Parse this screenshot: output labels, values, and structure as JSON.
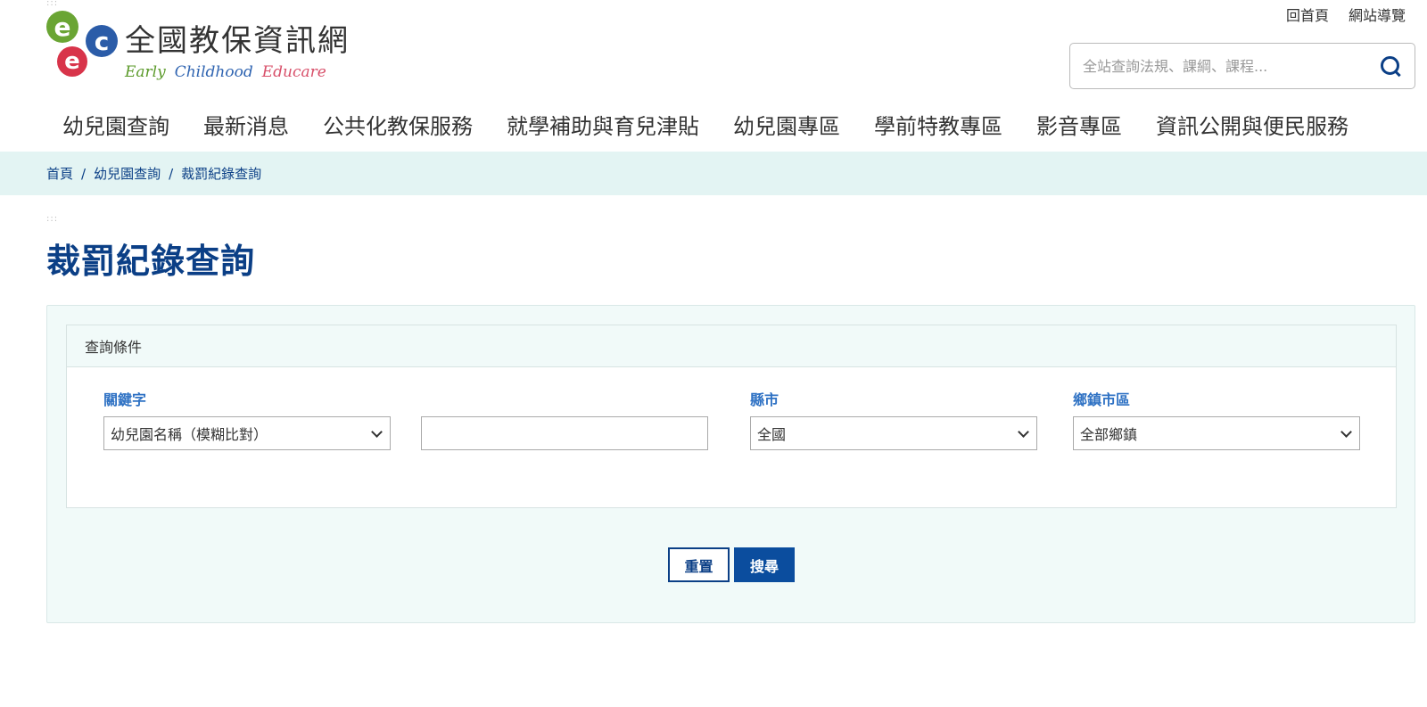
{
  "logo": {
    "title": "全國教保資訊網",
    "subtitle_1": "Early",
    "subtitle_2": "Childhood",
    "subtitle_3": "Educare",
    "colors": {
      "green": "#6aa534",
      "blue": "#2b5ca8",
      "red": "#d8344a"
    }
  },
  "top_links": {
    "home": "回首頁",
    "sitemap": "網站導覽"
  },
  "search": {
    "placeholder": "全站查詢法規、課綱、課程..."
  },
  "nav": [
    "幼兒園查詢",
    "最新消息",
    "公共化教保服務",
    "就學補助與育兒津貼",
    "幼兒園專區",
    "學前特教專區",
    "影音專區",
    "資訊公開與便民服務"
  ],
  "breadcrumb": {
    "home": "首頁",
    "level2": "幼兒園查詢",
    "current": "裁罰紀錄查詢",
    "sep": "/"
  },
  "page": {
    "title": "裁罰紀錄查詢"
  },
  "query": {
    "legend": "查詢條件",
    "keyword_label": "關鍵字",
    "keyword_type_value": "幼兒園名稱（模糊比對）",
    "keyword_text_value": "",
    "county_label": "縣市",
    "county_value": "全國",
    "township_label": "鄉鎮市區",
    "township_value": "全部鄉鎮",
    "reset_label": "重置",
    "search_label": "搜尋"
  },
  "colors": {
    "accent": "#0b3f86",
    "label_blue": "#2f72c4",
    "breadcrumb_bg": "#e3f4f3",
    "panel_bg": "#f1faf9"
  }
}
